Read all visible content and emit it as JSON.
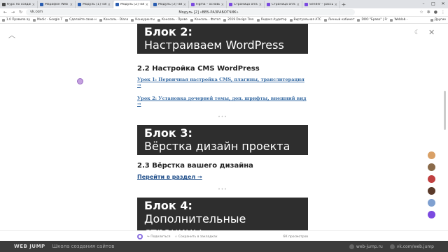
{
  "browser": {
    "tabs": [
      {
        "label": "Курс по созданию с",
        "color": "#4a4a4a",
        "active": false
      },
      {
        "label": "Марафон Web Jump",
        "color": "#2a5db0",
        "active": false
      },
      {
        "label": "Модуль [1] «ВЕБ-Р",
        "color": "#2a5db0",
        "active": false
      },
      {
        "label": "Модуль [2] «ВЕБ-Р",
        "color": "#2a5db0",
        "active": true
      },
      {
        "label": "Модуль [3] «ВЕБ-Р",
        "color": "#2a5db0",
        "active": false
      },
      {
        "label": "Figma – основы и б",
        "color": "#7b4ae0",
        "active": false
      },
      {
        "label": "Страница оплаты «",
        "color": "#7b4ae0",
        "active": false
      },
      {
        "label": "Страница оплаты «",
        "color": "#7b4ae0",
        "active": false
      },
      {
        "label": "Sender – рассылки и",
        "color": "#7b4ae0",
        "active": false
      }
    ],
    "url": "vk.com",
    "page_title": "Модуль [2] «ВЕБ-РАЗРАБОТЧИК»",
    "bookmarks": [
      "1.0 Правила ау",
      "Medic - Google T",
      "Сделайте свою н",
      "Консоль - Diana",
      "Конкуренты",
      "Консоль - Прове",
      "Консоль - Фотоп",
      "2019 Design Tren",
      "Яндекс.Аудитор",
      "Виртуальная АТС",
      "Личный кабинет",
      "DOO \"Браво\" | Fr",
      "Weblob -"
    ],
    "bookmarks_more": "Другие"
  },
  "article": {
    "block2_num": "Блок 2:",
    "block2_title": "Настраиваем WordPress",
    "section_22": "2.2 Настройка CMS WordPress",
    "lesson1": "Урок 1: Первичная настройка CMS, плагины, транслитерация →",
    "lesson2": "Урок 2: Установка дочерней темы, доп. шрифты, внешний вид →",
    "sep": "•••",
    "block3_num": "Блок 3:",
    "block3_title": "Вёрстка дизайн проекта",
    "section_23": "2.3 Вёрстка вашего дизайна",
    "goto": "Перейти в раздел →",
    "block4_num": "Блок 4:",
    "block4_title": "Дополнительные страницы"
  },
  "toolbar": {
    "share": "Поделиться",
    "save": "Сохранить в закладках",
    "views": "6К просмотров"
  },
  "footer": {
    "brand": "WEB JUMP",
    "school": "Школа создания сайтов",
    "site": "web-jump.ru",
    "vk": "vk.com/web.jump"
  },
  "avatars": [
    "#d9a066",
    "#8a6a4a",
    "#c04040",
    "#5a3a2a",
    "#7fa0d0",
    "#7b4ae0"
  ],
  "colors": {
    "block_bg": "#2e2e2e",
    "link": "#3b6ea5",
    "footer_bg": "#3c3c3c"
  }
}
